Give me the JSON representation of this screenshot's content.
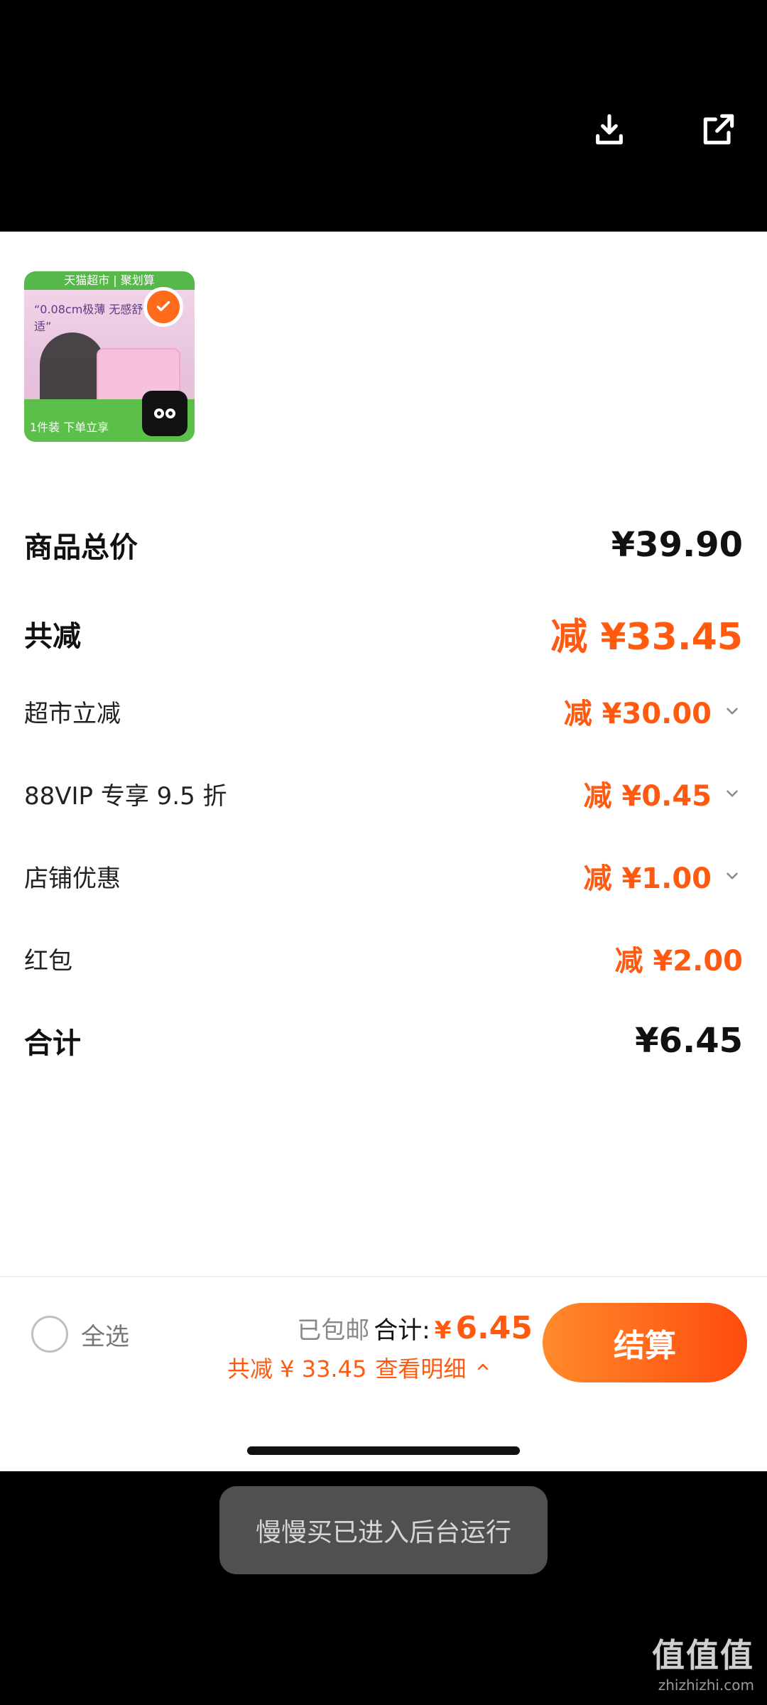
{
  "top_actions": {
    "download_icon": "download-icon",
    "share_icon": "share-icon"
  },
  "product": {
    "thumb_badge_text": "天猫超市 | 聚划算",
    "thumb_slogan": "“0.08cm极薄 无感舒适”",
    "thumb_bottom_text": "1件装 下单立享"
  },
  "summary_rows": [
    {
      "label": "商品总价",
      "value": "¥39.90",
      "emphasis": "big",
      "chevron": false
    },
    {
      "label": "共减",
      "value": "减 ¥33.45",
      "emphasis": "orange-big",
      "chevron": false
    },
    {
      "label": "超市立减",
      "value": "减 ¥30.00",
      "emphasis": "orange",
      "chevron": true
    },
    {
      "label": "88VIP 专享 9.5 折",
      "value": "减 ¥0.45",
      "emphasis": "orange",
      "chevron": true
    },
    {
      "label": "店铺优惠",
      "value": "减 ¥1.00",
      "emphasis": "orange",
      "chevron": true
    },
    {
      "label": "红包",
      "value": "减 ¥2.00",
      "emphasis": "orange",
      "chevron": false
    },
    {
      "label": "合计",
      "value": "¥6.45",
      "emphasis": "big",
      "chevron": false
    }
  ],
  "footer": {
    "select_all": "全选",
    "shipping": "已包邮",
    "total_label": "合计:",
    "currency": "¥",
    "total_value": "6.45",
    "discount_text": "共减 ¥ 33.45",
    "details_text": "查看明细",
    "checkout": "结算"
  },
  "toast": "慢慢买已进入后台运行",
  "watermark": {
    "big": "值值值",
    "small": "zhizhizhi.com"
  },
  "colors": {
    "accent": "#ff5a10",
    "checkout_start": "#ff8a2a",
    "checkout_end": "#ff4b0f"
  }
}
